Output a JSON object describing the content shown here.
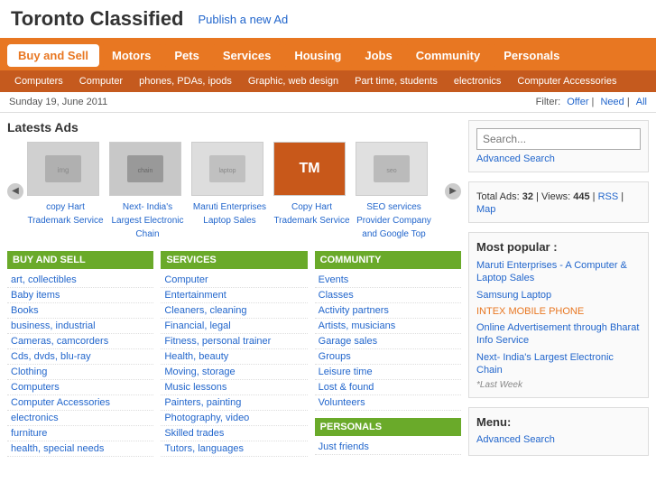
{
  "header": {
    "logo_first": "Toronto ",
    "logo_second": "Classified",
    "publish_btn": "Publish a new Ad"
  },
  "nav": {
    "items": [
      {
        "label": "Buy and Sell",
        "active": true
      },
      {
        "label": "Motors",
        "active": false
      },
      {
        "label": "Pets",
        "active": false
      },
      {
        "label": "Services",
        "active": false
      },
      {
        "label": "Housing",
        "active": false
      },
      {
        "label": "Jobs",
        "active": false
      },
      {
        "label": "Community",
        "active": false
      },
      {
        "label": "Personals",
        "active": false
      }
    ]
  },
  "subnav": {
    "items": [
      {
        "label": "Computers"
      },
      {
        "label": "Computer"
      },
      {
        "label": "phones, PDAs, ipods"
      },
      {
        "label": "Graphic, web design"
      },
      {
        "label": "Part time, students"
      },
      {
        "label": "electronics"
      },
      {
        "label": "Computer Accessories"
      }
    ]
  },
  "datebar": {
    "date": "Sunday 19, June 2011",
    "filter_label": "Filter:",
    "filter_offer": "Offer",
    "filter_need": "Need",
    "filter_all": "All"
  },
  "latest_ads": {
    "title": "Latests Ads",
    "items": [
      {
        "label": "copy Hart Trademark Service",
        "type": "img1"
      },
      {
        "label": "Next- India's Largest Electronic Chain",
        "type": "img2"
      },
      {
        "label": "Maruti Enterprises Laptop Sales",
        "type": "img3"
      },
      {
        "label": "Copy Hart Trademark Service",
        "type": "img4"
      },
      {
        "label": "SEO services Provider Company and Google Top",
        "type": "img5"
      }
    ]
  },
  "categories": {
    "buy_and_sell": {
      "header": "BUY AND SELL",
      "items": [
        "art, collectibles",
        "Baby items",
        "Books",
        "business, industrial",
        "Cameras, camcorders",
        "Cds, dvds, blu-ray",
        "Clothing",
        "Computers",
        "Computer Accessories",
        "electronics",
        "furniture",
        "health, special needs"
      ]
    },
    "services": {
      "header": "SERVICES",
      "items": [
        "Computer",
        "Entertainment",
        "Cleaners, cleaning",
        "Financial, legal",
        "Fitness, personal trainer",
        "Health, beauty",
        "Moving, storage",
        "Music lessons",
        "Painters, painting",
        "Photography, video",
        "Skilled trades",
        "Tutors, languages"
      ]
    },
    "community": {
      "header": "COMMUNITY",
      "items": [
        "Events",
        "Classes",
        "Activity partners",
        "Artists, musicians",
        "Garage sales",
        "Groups",
        "Leisure time",
        "Lost & found",
        "Volunteers"
      ]
    },
    "personals": {
      "header": "PERSONALS",
      "items": [
        "Just friends"
      ]
    }
  },
  "sidebar": {
    "search_placeholder": "Search...",
    "advanced_search": "Advanced Search",
    "stats": {
      "label": "Total Ads:",
      "total": "32",
      "views_label": "Views:",
      "views": "445",
      "rss": "RSS",
      "map": "Map"
    },
    "most_popular": {
      "title": "Most popular :",
      "items": [
        {
          "label": "Maruti Enterprises - A Computer & Laptop Sales",
          "orange": false
        },
        {
          "label": "Samsung Laptop",
          "orange": false
        },
        {
          "label": "INTEX MOBILE PHONE",
          "orange": true
        },
        {
          "label": "Online Advertisement through Bharat Info Service",
          "orange": false
        },
        {
          "label": "Next- India's Largest Electronic Chain",
          "orange": false
        }
      ],
      "last_week": "*Last Week"
    },
    "menu": {
      "title": "Menu:",
      "items": [
        {
          "label": "Advanced Search"
        }
      ]
    }
  }
}
